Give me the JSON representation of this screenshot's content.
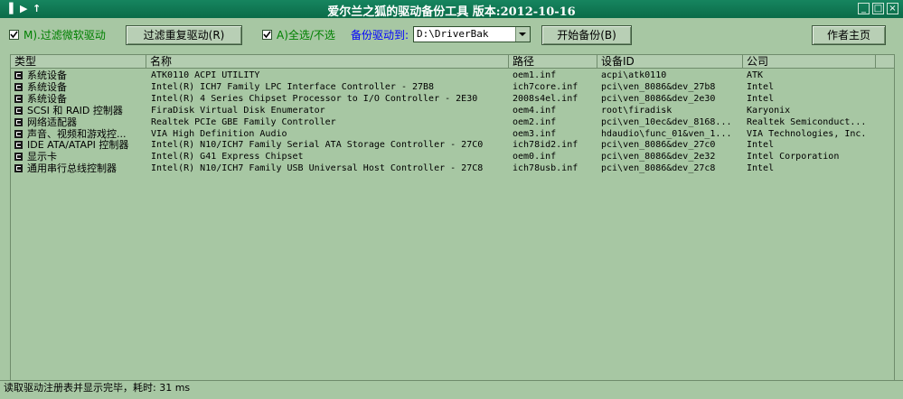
{
  "window": {
    "title": "爱尔兰之狐的驱动备份工具  版本:2012-10-16",
    "left_icons": [
      "▐",
      "▶",
      "↑"
    ],
    "controls": [
      "_",
      "□",
      "×"
    ]
  },
  "toolbar": {
    "filter_ms_label": "M).过滤微软驱动",
    "filter_dup_button": "过滤重复驱动(R)",
    "select_all_label": "A)全选/不选",
    "backup_to_label": "备份驱动到:",
    "backup_path_value": "D:\\DriverBak",
    "start_backup_button": "开始备份(B)",
    "author_home_button": "作者主页"
  },
  "table": {
    "columns": [
      "类型",
      "名称",
      "路径",
      "设备ID",
      "公司"
    ],
    "rows": [
      {
        "type": "系统设备",
        "name": "ATK0110 ACPI UTILITY",
        "path": "oem1.inf",
        "device_id": "acpi\\atk0110",
        "company": "ATK"
      },
      {
        "type": "系统设备",
        "name": "Intel(R) ICH7 Family LPC Interface Controller - 27B8",
        "path": "ich7core.inf",
        "device_id": "pci\\ven_8086&dev_27b8",
        "company": "Intel"
      },
      {
        "type": "系统设备",
        "name": "Intel(R) 4 Series Chipset Processor to I/O Controller - 2E30",
        "path": "2008s4el.inf",
        "device_id": "pci\\ven_8086&dev_2e30",
        "company": "Intel"
      },
      {
        "type": "SCSI 和 RAID 控制器",
        "name": "FiraDisk Virtual Disk Enumerator",
        "path": "oem4.inf",
        "device_id": "root\\firadisk",
        "company": "Karyonix"
      },
      {
        "type": "网络适配器",
        "name": "Realtek PCIe GBE Family Controller",
        "path": "oem2.inf",
        "device_id": "pci\\ven_10ec&dev_8168...",
        "company": "Realtek Semiconduct..."
      },
      {
        "type": "声音、视频和游戏控...",
        "name": "VIA High Definition Audio",
        "path": "oem3.inf",
        "device_id": "hdaudio\\func_01&ven_1...",
        "company": "VIA Technologies, Inc."
      },
      {
        "type": "IDE ATA/ATAPI 控制器",
        "name": "Intel(R) N10/ICH7 Family Serial ATA Storage Controller - 27C0",
        "path": "ich78id2.inf",
        "device_id": "pci\\ven_8086&dev_27c0",
        "company": "Intel"
      },
      {
        "type": "显示卡",
        "name": "Intel(R) G41 Express Chipset",
        "path": "oem0.inf",
        "device_id": "pci\\ven_8086&dev_2e32",
        "company": "Intel Corporation"
      },
      {
        "type": "通用串行总线控制器",
        "name": "Intel(R) N10/ICH7 Family USB Universal Host Controller - 27C8",
        "path": "ich78usb.inf",
        "device_id": "pci\\ven_8086&dev_27c8",
        "company": "Intel"
      }
    ]
  },
  "status": {
    "text": "读取驱动注册表并显示完毕，耗时: 31 ms"
  },
  "colors": {
    "background": "#a7c7a3",
    "titlebar": "#0e7451",
    "blue_label": "#0000ff",
    "green_label": "#008000"
  }
}
